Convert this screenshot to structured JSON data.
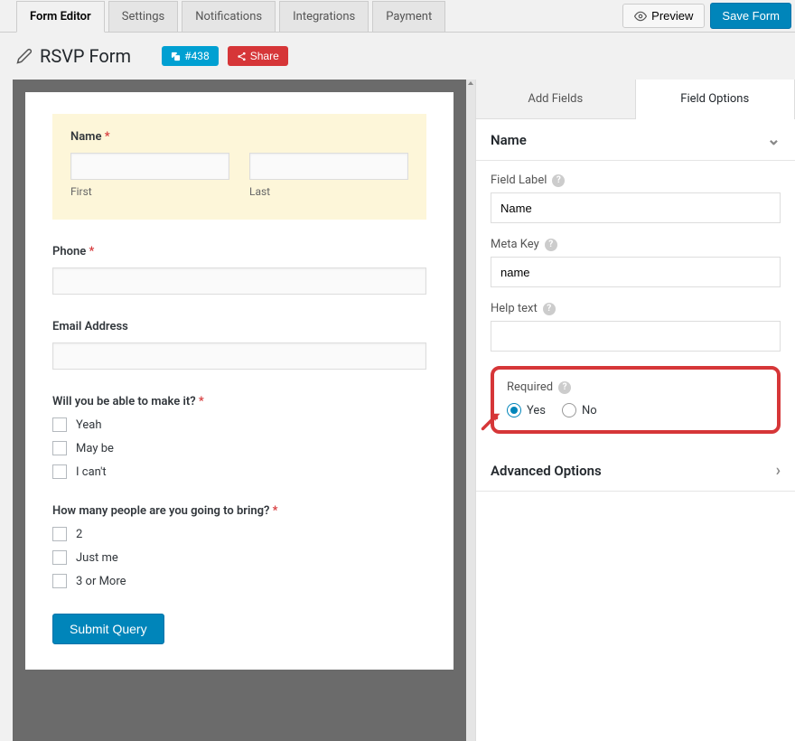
{
  "topTabs": {
    "formEditor": "Form Editor",
    "settings": "Settings",
    "notifications": "Notifications",
    "integrations": "Integrations",
    "payment": "Payment"
  },
  "actions": {
    "preview": "Preview",
    "save": "Save Form"
  },
  "header": {
    "title": "RSVP Form",
    "badge": "#438",
    "share": "Share"
  },
  "form": {
    "nameLabel": "Name",
    "firstSub": "First",
    "lastSub": "Last",
    "phoneLabel": "Phone",
    "emailLabel": "Email Address",
    "attendLabel": "Will you be able to make it?",
    "attendOpts": {
      "yeah": "Yeah",
      "maybe": "May be",
      "cant": "I can't"
    },
    "peopleLabel": "How many people are you going to bring?",
    "peopleOpts": {
      "two": "2",
      "justme": "Just me",
      "three": "3 or More"
    },
    "submit": "Submit Query"
  },
  "sidebar": {
    "addFields": "Add Fields",
    "fieldOptions": "Field Options",
    "sectionName": "Name",
    "fieldLabel": {
      "label": "Field Label",
      "value": "Name"
    },
    "metaKey": {
      "label": "Meta Key",
      "value": "name"
    },
    "helpText": {
      "label": "Help text",
      "value": ""
    },
    "required": {
      "label": "Required",
      "yes": "Yes",
      "no": "No"
    },
    "advanced": "Advanced Options"
  }
}
